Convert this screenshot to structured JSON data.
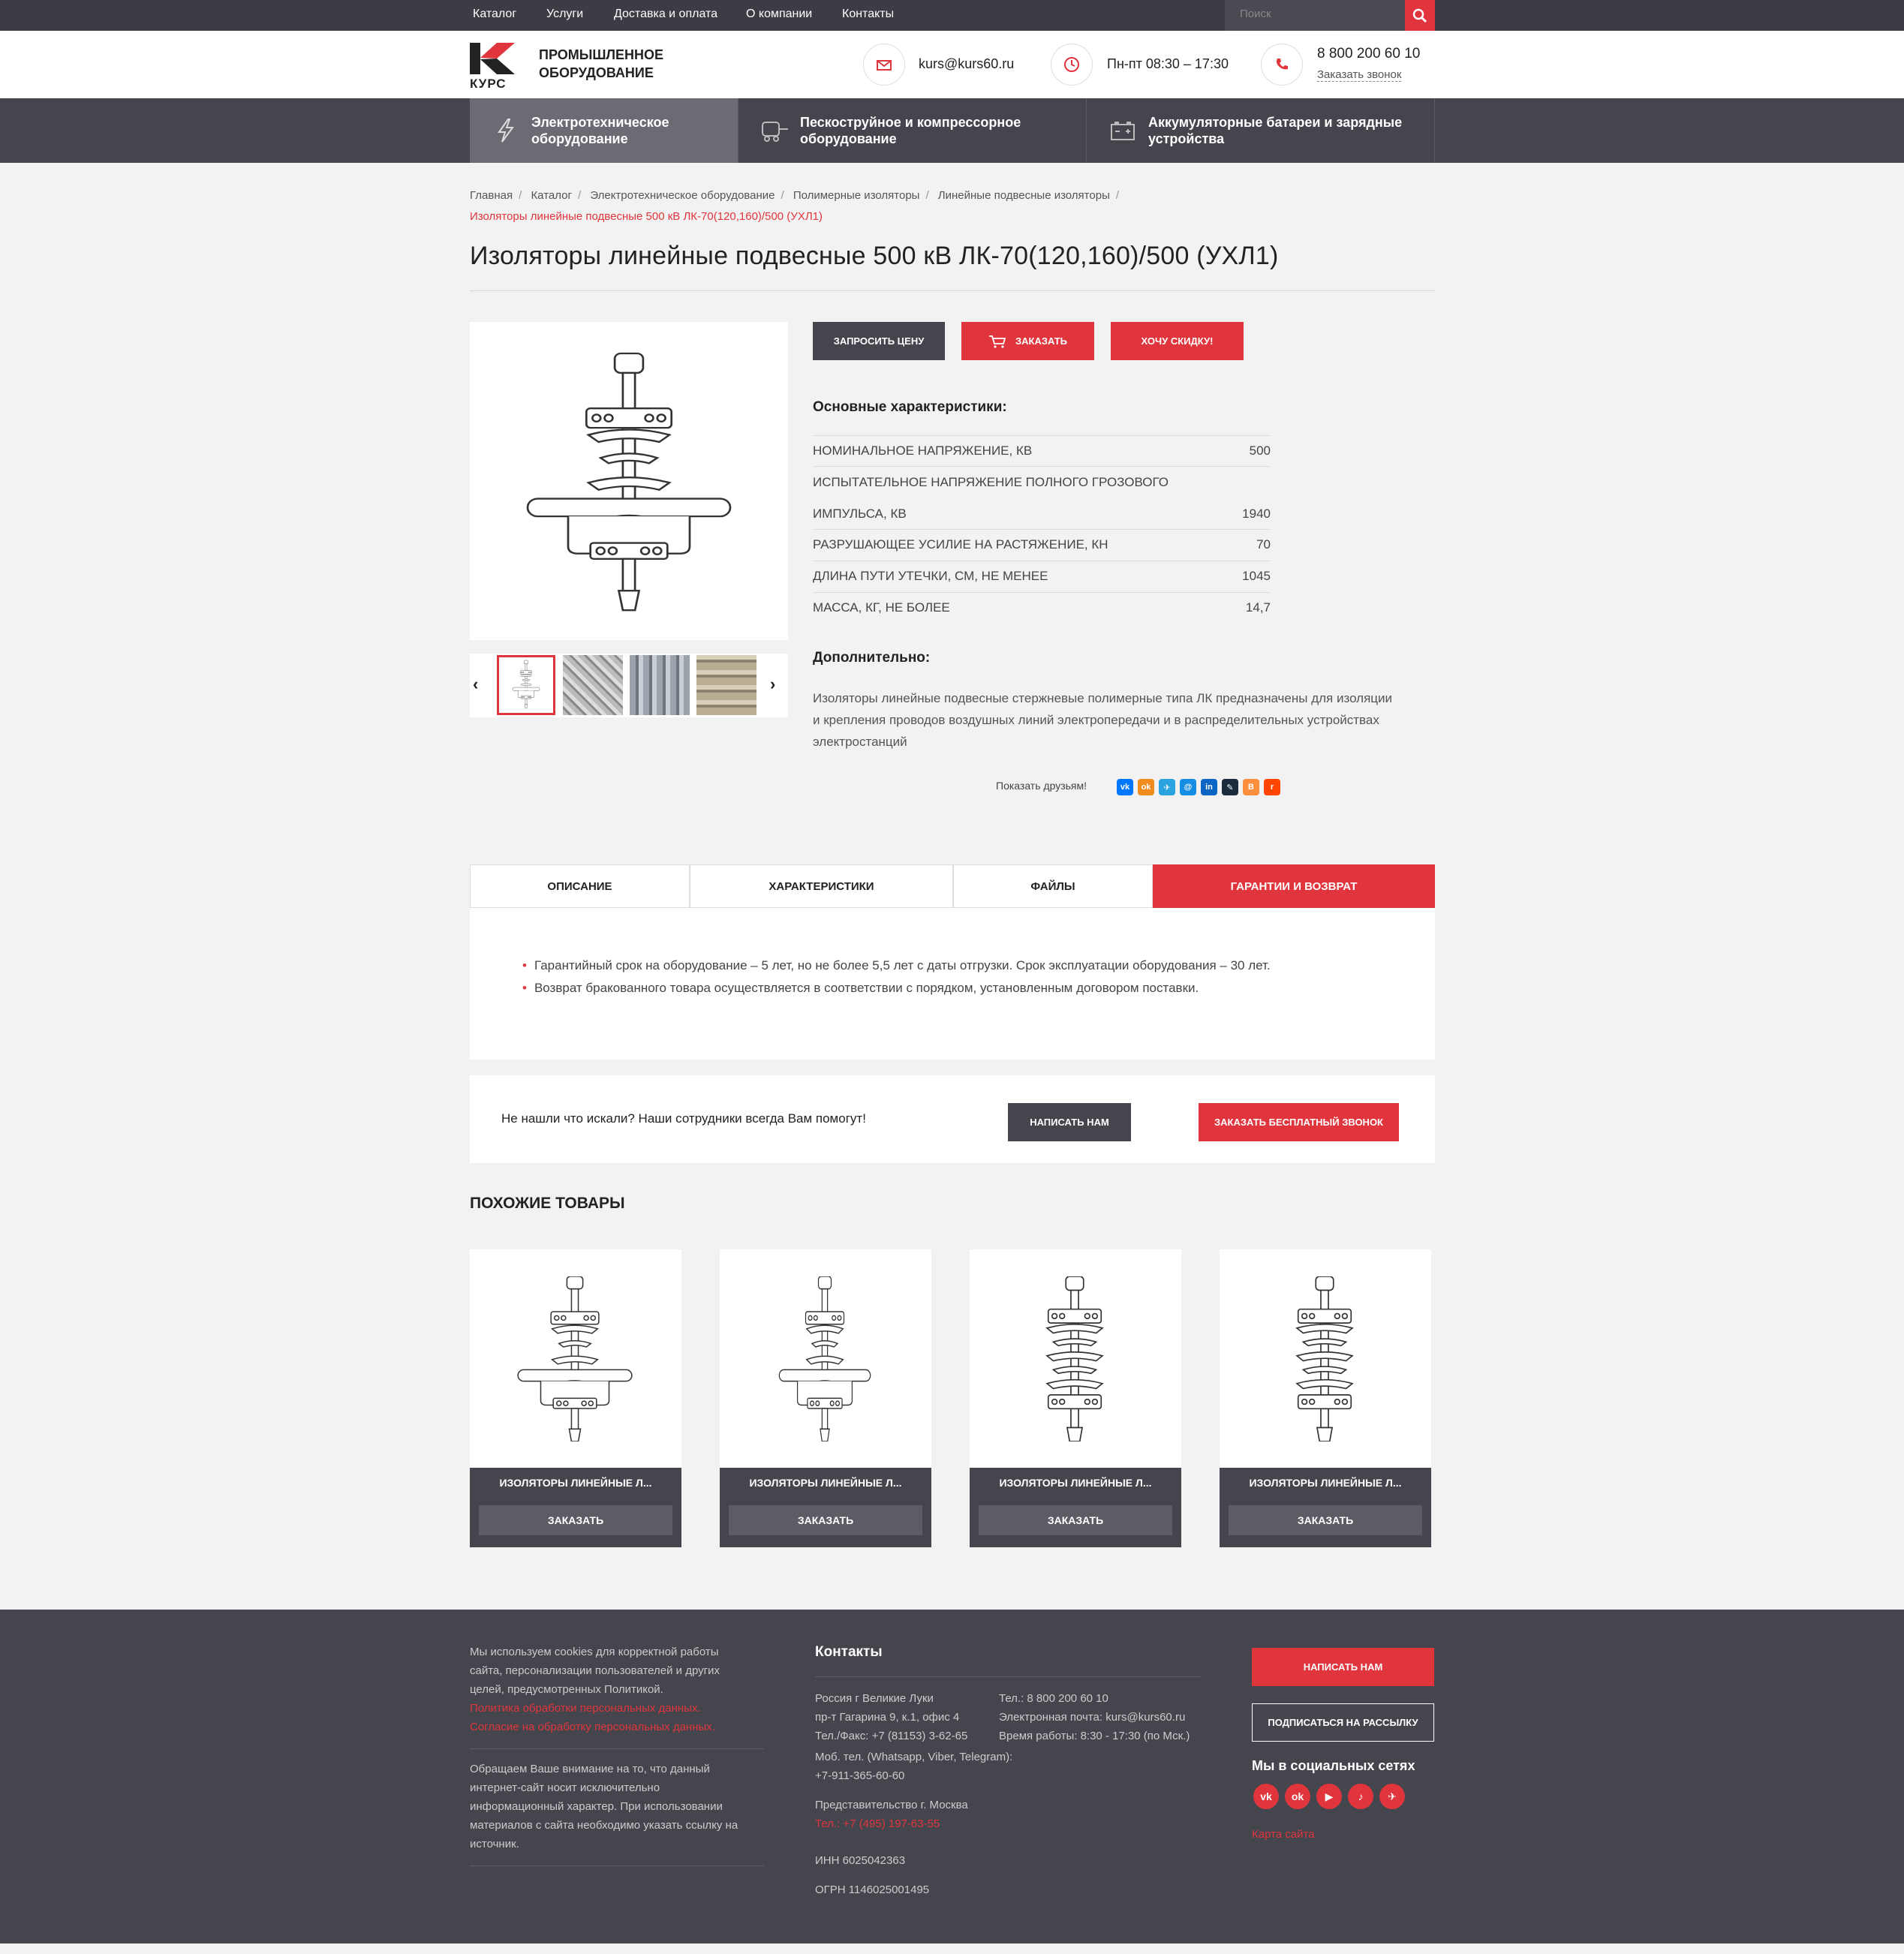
{
  "topnav": {
    "items": [
      "Каталог",
      "Услуги",
      "Доставка и оплата",
      "О компании",
      "Контакты"
    ],
    "search_placeholder": "Поиск"
  },
  "header": {
    "logo_text": "КУРС",
    "tagline_1": "ПРОМЫШЛЕННОЕ",
    "tagline_2": "ОБОРУДОВАНИЕ",
    "email": "kurs@kurs60.ru",
    "hours": "Пн-пт 08:30 – 17:30",
    "phone": "8 800 200 60 10",
    "callback": "Заказать звонок"
  },
  "categories": [
    {
      "label_1": "Электротехническое",
      "label_2": "оборудование"
    },
    {
      "label_1": "Пескоструйное и компрессорное",
      "label_2": "оборудование"
    },
    {
      "label_1": "Аккумуляторные батареи и зарядные",
      "label_2": "устройства"
    }
  ],
  "breadcrumbs": [
    "Главная",
    "Каталог",
    "Электротехническое оборудование",
    "Полимерные изоляторы",
    "Линейные подвесные изоляторы"
  ],
  "breadcrumb_current": "Изоляторы линейные подвесные 500 кВ ЛК-70(120,160)/500 (УХЛ1)",
  "title": "Изоляторы линейные подвесные 500 кВ ЛК-70(120,160)/500 (УХЛ1)",
  "buttons": {
    "request_price": "Запросить цену",
    "order": "Заказать",
    "discount": "Хочу скидку!"
  },
  "specs_title": "Основные характеристики:",
  "specs": [
    {
      "name": "НОМИНАЛЬНОЕ НАПРЯЖЕНИЕ, КВ",
      "value": "500"
    },
    {
      "name": "ИСПЫТАТЕЛЬНОЕ НАПРЯЖЕНИЕ ПОЛНОГО ГРОЗОВОГО",
      "value": ""
    },
    {
      "name": "ИМПУЛЬСА, КВ",
      "value": "1940"
    },
    {
      "name": "РАЗРУШАЮЩЕЕ УСИЛИЕ НА РАСТЯЖЕНИЕ, КН",
      "value": "70"
    },
    {
      "name": "ДЛИНА ПУТИ УТЕЧКИ, СМ, НЕ МЕНЕЕ",
      "value": "1045"
    },
    {
      "name": "МАССА, КГ, НЕ БОЛЕЕ",
      "value": "14,7"
    }
  ],
  "additional_title": "Дополнительно:",
  "additional_text_1": "Изоляторы линейные подвесные стержневые полимерные типа ЛК предназначены для изоляции",
  "additional_text_2": "и крепления проводов воздушных линий электропередачи и в распределительных устройствах",
  "additional_text_3": "электростанций",
  "share_label": "Показать друзьям!",
  "share_icons": [
    "vk",
    "ok",
    "tg",
    "mm",
    "in",
    "lj",
    "bl",
    "rd"
  ],
  "tabs": [
    "Описание",
    "Характеристики",
    "Файлы",
    "Гарантии и возврат"
  ],
  "tab_content": [
    "Гарантийный срок на оборудование – 5 лет, но не более 5,5 лет с даты отгрузки. Срок эксплуатации оборудования – 30 лет.",
    "Возврат бракованного товара осуществляется в соответствии с порядком, установленным договором поставки."
  ],
  "help": {
    "text": "Не нашли что искали? Наши сотрудники всегда Вам помогут!",
    "write_btn": "Написать нам",
    "call_btn": "Заказать бесплатный звонок"
  },
  "similar_title": "ПОХОЖИЕ ТОВАРЫ",
  "similar": [
    {
      "title": "ИЗОЛЯТОРЫ ЛИНЕЙНЫЕ Л...",
      "btn": "ЗАКАЗАТЬ"
    },
    {
      "title": "ИЗОЛЯТОРЫ ЛИНЕЙНЫЕ Л...",
      "btn": "ЗАКАЗАТЬ"
    },
    {
      "title": "ИЗОЛЯТОРЫ ЛИНЕЙНЫЕ Л...",
      "btn": "ЗАКАЗАТЬ"
    },
    {
      "title": "ИЗОЛЯТОРЫ ЛИНЕЙНЫЕ Л...",
      "btn": "ЗАКАЗАТЬ"
    }
  ],
  "footer": {
    "cookies": [
      "Мы используем cookies для корректной работы",
      "сайта, персонализации пользователей и других",
      "целей, предусмотренных Политикой."
    ],
    "policy_1": "Политика обработки персональных данных.",
    "policy_2": "Согласие на обработку персональных данных.",
    "notice": [
      "Обращаем Ваше внимание на то, что данный",
      "интернет-сайт носит исключительно",
      "информационный характер. При использовании",
      "материалов с сайта необходимо указать ссылку на",
      "источник."
    ],
    "contacts_title": "Контакты",
    "addr": [
      "Россия г Великие Луки",
      "пр-т Гагарина 9, к.1, офис 4",
      "Тел./Факс: +7 (81153) 3-62-65"
    ],
    "phones": [
      "Тел.: 8 800 200 60 10",
      "Электронная почта: kurs@kurs60.ru",
      "Время работы: 8:30 - 17:30 (по Мск.)"
    ],
    "mobile_label": "Моб. тел. (Whatsapp, Viber, Telegram):",
    "mobile": "+7-911-365-60-60",
    "moscow_label": "Представительство г. Москва",
    "moscow_phone": "Тел.: +7 (495) 197-63-55",
    "inn": "ИНН 6025042363",
    "ogrn": "ОГРН 1146025001495",
    "write_btn": "Написать нам",
    "subscribe_btn": "Подписаться на рассылку",
    "social_title": "Мы в социальных сетях",
    "social": [
      "vk",
      "ok",
      "yt",
      "tt",
      "tg"
    ],
    "sitemap": "Карта сайта"
  },
  "colors": {
    "accent": "#e0353d",
    "dark": "#45454d",
    "topbar": "#3c3c44"
  }
}
